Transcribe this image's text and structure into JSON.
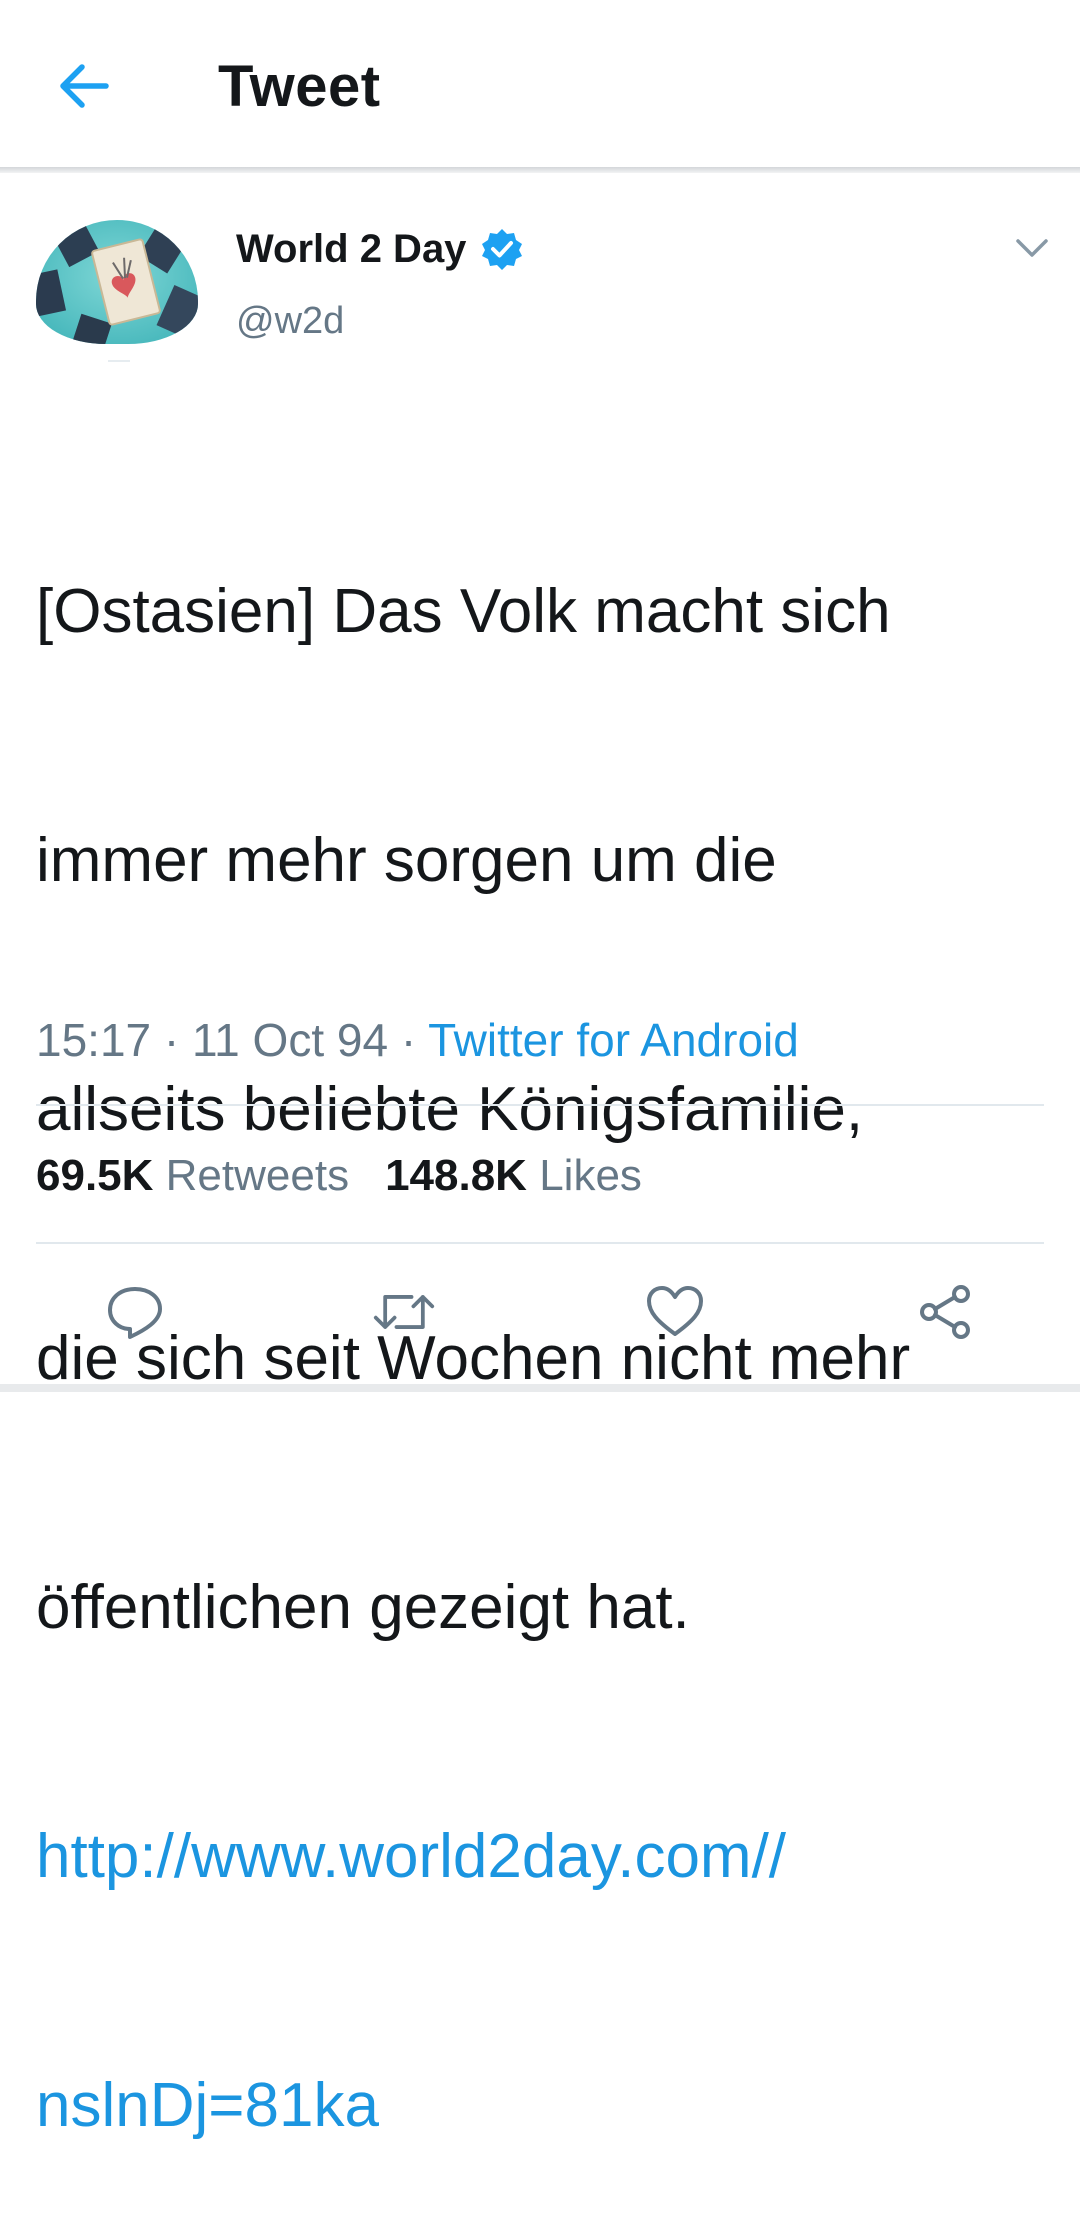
{
  "header": {
    "title": "Tweet",
    "back_icon": "arrow-left-icon"
  },
  "tweet": {
    "author": {
      "display_name": "World 2 Day",
      "handle": "@w2d",
      "verified": true,
      "avatar_icon": "tarot-cards-avatar"
    },
    "text_lines": [
      "[Ostasien] Das Volk macht sich",
      "immer mehr sorgen um die",
      "allseits beliebte Königsfamilie,",
      "die sich seit Wochen nicht mehr",
      "öffentlichen gezeigt hat."
    ],
    "link_lines": [
      "http://www.world2day.com//",
      "nslnDj=81ka"
    ],
    "time": "15:17",
    "separator": " · ",
    "date": "11 Oct 94",
    "source": "Twitter for Android",
    "stats": {
      "retweets_count": "69.5K",
      "retweets_label": "Retweets",
      "likes_count": "148.8K",
      "likes_label": "Likes"
    }
  },
  "actions": [
    {
      "name": "reply",
      "icon": "reply-icon"
    },
    {
      "name": "retweet",
      "icon": "retweet-icon"
    },
    {
      "name": "like",
      "icon": "heart-icon"
    },
    {
      "name": "share",
      "icon": "share-icon"
    }
  ],
  "colors": {
    "accent": "#1da1f2",
    "link": "#1b95e0",
    "text": "#14171a",
    "secondary": "#657786",
    "divider": "#e1e8ed"
  }
}
